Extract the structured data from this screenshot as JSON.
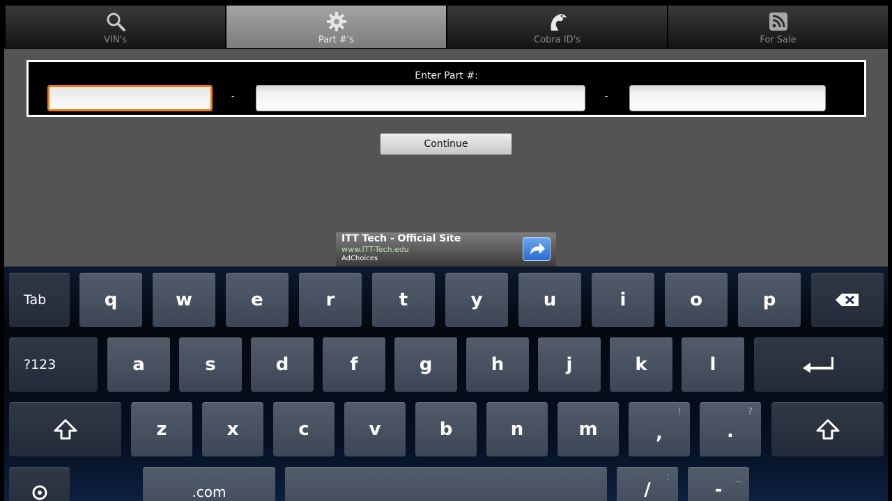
{
  "tabs": [
    {
      "label": "VIN's",
      "icon": "search-icon",
      "active": false
    },
    {
      "label": "Part #'s",
      "icon": "gear-icon",
      "active": true
    },
    {
      "label": "Cobra ID's",
      "icon": "cobra-icon",
      "active": false
    },
    {
      "label": "For Sale",
      "icon": "rss-feed-icon",
      "active": false
    }
  ],
  "entry": {
    "label": "Enter Part #:",
    "separator": "-",
    "fields": [
      {
        "value": "",
        "focused": true
      },
      {
        "value": "",
        "focused": false
      },
      {
        "value": "",
        "focused": false
      }
    ]
  },
  "continue_label": "Continue",
  "ad": {
    "title": "ITT Tech - Official Site",
    "url": "www.ITT-Tech.edu",
    "choices": "AdChoices",
    "icon": "share-arrow-icon"
  },
  "keyboard": {
    "row1": [
      "Tab",
      "q",
      "w",
      "e",
      "r",
      "t",
      "y",
      "u",
      "i",
      "o",
      "p",
      "backspace"
    ],
    "row2": [
      "?123",
      "a",
      "s",
      "d",
      "f",
      "g",
      "h",
      "j",
      "k",
      "l",
      "enter"
    ],
    "row3": [
      "shift",
      "z",
      "x",
      "c",
      "v",
      "b",
      "n",
      "m",
      ",",
      ".",
      "shift"
    ],
    "row3_hints": {
      "comma": "!",
      "period": "?"
    },
    "row4": [
      "settings",
      ".com",
      "space",
      "/",
      "-"
    ],
    "row4_hints": {
      "slash": ":",
      "dash": "_"
    }
  },
  "colors": {
    "focus_orange": "#f07a0a",
    "active_tab": "#9a9a9a",
    "key_face": "#48515f",
    "ad_url_green": "#bfe6ae",
    "ad_button_blue": "#3b7ddc"
  }
}
